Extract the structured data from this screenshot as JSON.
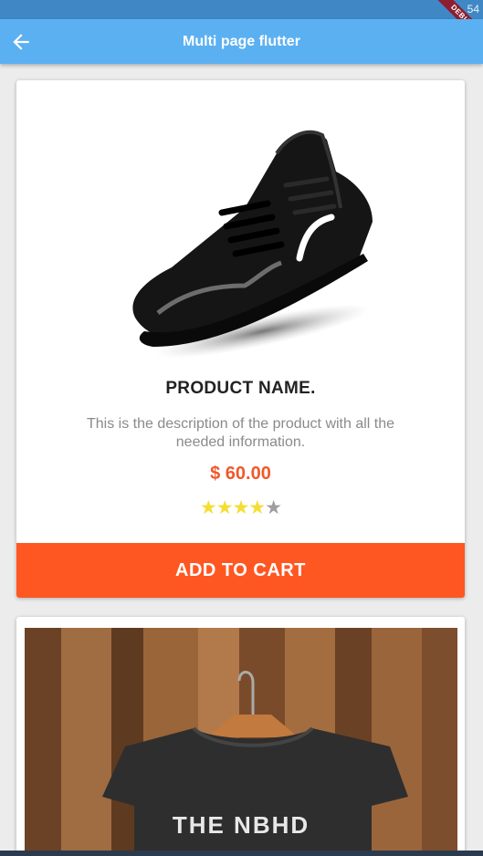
{
  "status_bar": {
    "time": "54",
    "debug_label": "DEBUG"
  },
  "app_bar": {
    "title": "Multi page flutter",
    "back_icon": "arrow-back-icon"
  },
  "product": {
    "name": "PRODUCT NAME.",
    "description": "This is the description of the product with all the needed information.",
    "price": "$ 60.00",
    "rating": {
      "filled": 4,
      "total": 5,
      "star_filled": "★★★★",
      "star_empty": "★"
    },
    "image_icon": "sneaker-image",
    "button_label": "ADD TO CART"
  },
  "second_product": {
    "image_text": "THE NBHD",
    "image_icon": "tshirt-image"
  },
  "colors": {
    "app_bar": "#5bb0f2",
    "status_bar": "#3f88c5",
    "accent": "#ff5722",
    "price": "#f0582a",
    "star": "#f5dd34"
  }
}
